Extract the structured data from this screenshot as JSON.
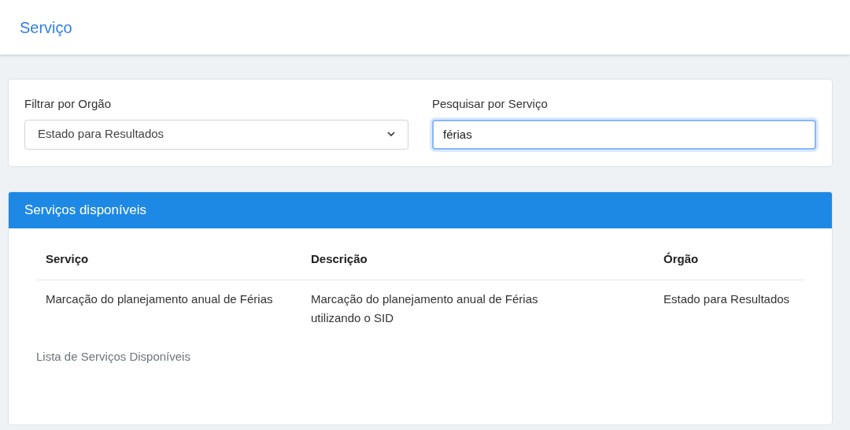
{
  "header": {
    "title": "Serviço"
  },
  "filters": {
    "organ_label": "Filtrar por Orgão",
    "organ_select": "Estado para Resultados",
    "search_label": "Pesquisar por Serviço",
    "search_value": "férias",
    "search_focused": true
  },
  "panel": {
    "title": "Serviços disponíveis",
    "table": {
      "columns": [
        "Serviço",
        "Descrição",
        "Órgão"
      ],
      "rows": [
        [
          "Marcação do planejamento anual de Férias",
          "Marcação do planejamento anual de Férias utilizando o SID",
          "Estado para Resultados"
        ]
      ],
      "caption": "Lista de Serviços Disponíveis"
    }
  }
}
